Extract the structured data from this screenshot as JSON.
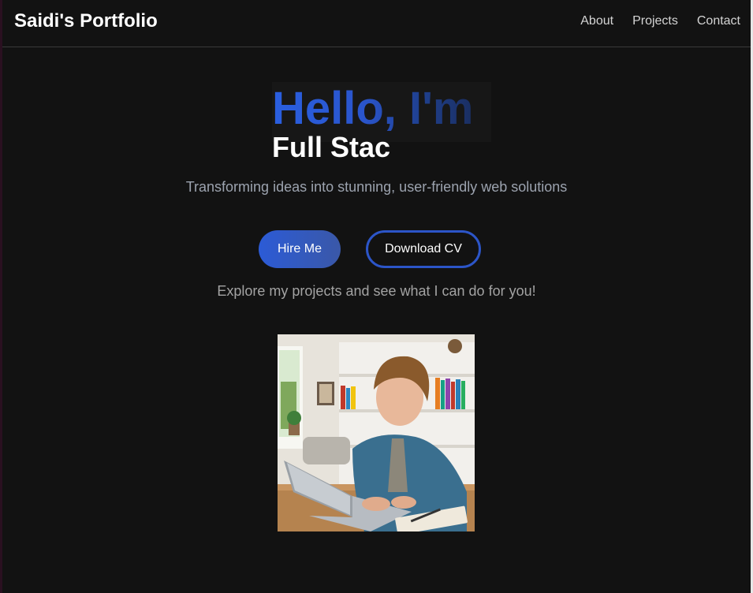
{
  "navbar": {
    "brand": "Saidi's Portfolio",
    "links": [
      {
        "label": "About"
      },
      {
        "label": "Projects"
      },
      {
        "label": "Contact"
      }
    ]
  },
  "hero": {
    "greeting": "Hello, I'm",
    "role": "Full Stac",
    "tagline": "Transforming ideas into stunning, user-friendly web solutions",
    "hire_label": "Hire Me",
    "cv_label": "Download CV",
    "explore": "Explore my projects and see what I can do for you!"
  },
  "colors": {
    "background": "#121212",
    "accent": "#2c5bd6",
    "muted_text": "#9ca3af"
  }
}
